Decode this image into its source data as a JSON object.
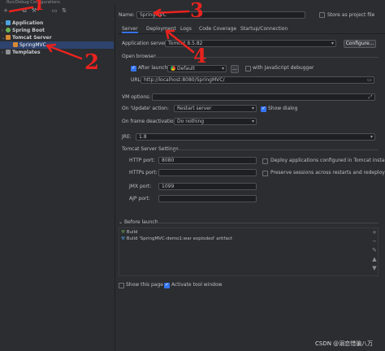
{
  "window": {
    "title": "Run/Debug Configurations"
  },
  "toolbar": {
    "icons": [
      "add-icon",
      "remove-icon",
      "copy-icon",
      "wrench-icon",
      "folder-icon",
      "sort-icon"
    ],
    "add": "+",
    "remove": "−",
    "copy": "⧉",
    "wrench": "⚒",
    "folder": "▭",
    "sort": "⇅"
  },
  "tree": {
    "items": [
      {
        "label": "Application",
        "color": "#4fa3e0"
      },
      {
        "label": "Spring Boot",
        "color": "#6bb052"
      },
      {
        "label": "Tomcat Server",
        "color": "#d88a33"
      },
      {
        "label": "SpringMVC",
        "color": "#d88a33"
      },
      {
        "label": "Templates",
        "color": "#8c8f94"
      }
    ],
    "arrow_collapsed": "›",
    "arrow_expanded": "⌄"
  },
  "name": {
    "label": "Name:",
    "value": "SpringMVC"
  },
  "store_project": {
    "label": "Store as project file",
    "checked": false
  },
  "tabs": [
    "Server",
    "Deployment",
    "Logs",
    "Code Coverage",
    "Startup/Connection"
  ],
  "server": {
    "app_server_label": "Application server:",
    "app_server_value": "Tomcat 8.5.82",
    "configure_label": "Configure...",
    "open_browser_label": "Open browser",
    "after_launch_label": "After launch",
    "after_launch_checked": true,
    "browser_value": "Default",
    "browser_more": "...",
    "js_debugger_label": "with JavaScript debugger",
    "js_debugger_checked": false,
    "url_label": "URL:",
    "url_value": "http://localhost:8080/SpringMVC/",
    "vm_label": "VM options:",
    "vm_value": "",
    "update_label": "On 'Update' action:",
    "update_value": "Restart server",
    "show_dialog_label": "Show dialog",
    "show_dialog_checked": true,
    "deactivation_label": "On frame deactivation:",
    "deactivation_value": "Do nothing",
    "jre_label": "JRE:",
    "jre_value": "1.8",
    "tomcat_settings_label": "Tomcat Server Settings",
    "http_port_label": "HTTP port:",
    "http_port_value": "8080",
    "https_port_label": "HTTPs port:",
    "https_port_value": "",
    "jmx_port_label": "JMX port:",
    "jmx_port_value": "1099",
    "ajp_port_label": "AJP port:",
    "ajp_port_value": "",
    "deploy_apps_label": "Deploy applications configured in Tomcat instance",
    "deploy_apps_checked": false,
    "preserve_label": "Preserve sessions across restarts and redeploys",
    "preserve_checked": false
  },
  "before_launch": {
    "label": "Before launch",
    "items": [
      "Build",
      "Build 'SpringMVC-demo1:war exploded' artifact"
    ],
    "tools": [
      "+",
      "−",
      "✎",
      "▲",
      "▼"
    ]
  },
  "footer": {
    "show_page_label": "Show this page",
    "show_page_checked": false,
    "activate_label": "Activate tool window",
    "activate_checked": true
  },
  "watermark": "CSDN @溺恋惜骗八万",
  "annotations": {
    "n1": "1",
    "n2": "2",
    "n3": "3",
    "n4": "4",
    "color": "#e8231f"
  }
}
